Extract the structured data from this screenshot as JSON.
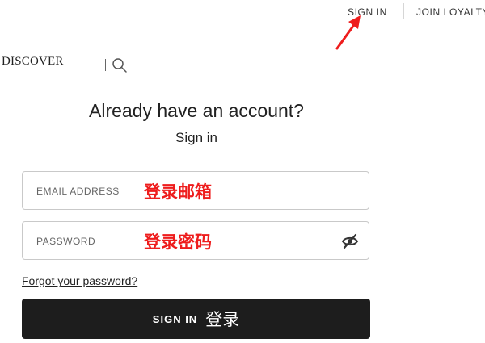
{
  "top_nav": {
    "sign_in": "SIGN IN",
    "loyalty": "JOIN LOYALTY"
  },
  "header": {
    "brand": "DISCOVER"
  },
  "main": {
    "heading": "Already have an account?",
    "subheading": "Sign in",
    "email_field": {
      "placeholder": "EMAIL ADDRESS",
      "annotation": "登录邮箱"
    },
    "password_field": {
      "placeholder": "PASSWORD",
      "annotation": "登录密码"
    },
    "forgot_link": "Forgot your password?",
    "sign_in_button": {
      "label": "SIGN IN",
      "annotation": "登录"
    }
  },
  "icons": {
    "search": "search-icon",
    "password_toggle": "eye-slash-icon",
    "annotation_arrow": "red-arrow-icon"
  },
  "colors": {
    "annotation": "#ee1c1c",
    "button_bg": "#1d1d1d",
    "button_text": "#ffffff",
    "text": "#222222",
    "border": "#c9c9c9"
  }
}
